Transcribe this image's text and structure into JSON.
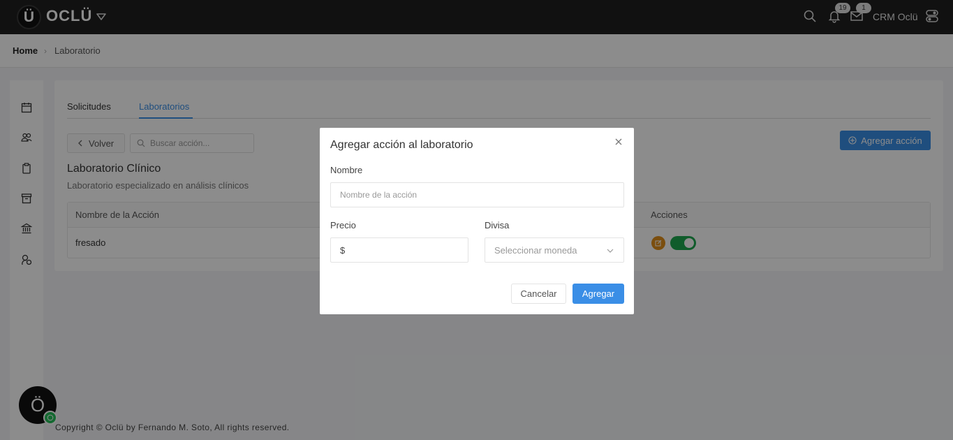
{
  "header": {
    "logo_letter": "Ü",
    "brand": "OCLÜ",
    "notifications_count": "19",
    "messages_count": "1",
    "user_name": "CRM Oclü",
    "icons": [
      "logo-icon",
      "caret-down-icon",
      "search-icon",
      "bell-icon",
      "mail-icon",
      "toggle-settings-icon"
    ]
  },
  "breadcrumb": {
    "home": "Home",
    "separator": "›",
    "current": "Laboratorio"
  },
  "sidebar": {
    "icons": [
      "calendar-icon",
      "users-icon",
      "clipboard-icon",
      "archive-icon",
      "bank-icon",
      "user-group-icon"
    ]
  },
  "main": {
    "tabs": [
      {
        "label": "Solicitudes",
        "active": false
      },
      {
        "label": "Laboratorios",
        "active": true
      }
    ],
    "back_label": "Volver",
    "search_placeholder": "Buscar acción...",
    "add_action_label": "Agregar acción",
    "lab_title": "Laboratorio Clínico",
    "lab_description": "Laboratorio especializado en análisis clínicos",
    "table": {
      "columns": [
        "Nombre de la Acción",
        "Acciones"
      ],
      "rows": [
        {
          "name": "fresado",
          "enabled": true
        }
      ]
    }
  },
  "footer": {
    "copyright": "Copyright © Oclü by Fernando M. Soto, All rights reserved.",
    "chat_letter": "Ö"
  },
  "modal": {
    "title": "Agregar acción al laboratorio",
    "name_label": "Nombre",
    "name_placeholder": "Nombre de la acción",
    "price_label": "Precio",
    "price_prefix": "$",
    "currency_label": "Divisa",
    "currency_placeholder": "Seleccionar moneda",
    "cancel_label": "Cancelar",
    "submit_label": "Agregar"
  },
  "colors": {
    "accent": "#3a8ee6",
    "topbar": "#1f1f1f",
    "toggle_on": "#1ea84f",
    "edit": "#e08e1a"
  }
}
